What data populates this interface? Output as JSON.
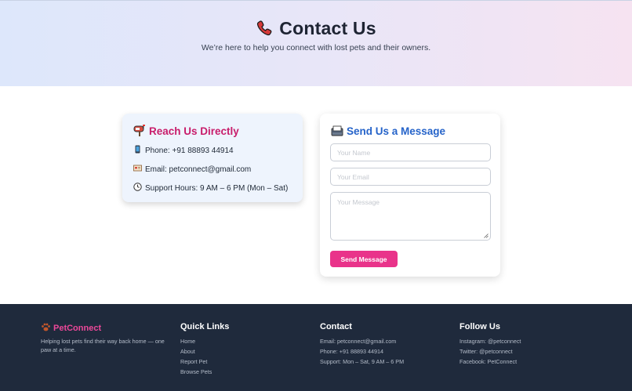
{
  "hero": {
    "title": "Contact Us",
    "subtitle": "We’re here to help you connect with lost pets and their owners.",
    "title_icon": "phone-icon"
  },
  "reach": {
    "heading": "Reach Us Directly",
    "heading_icon": "mailbox-icon",
    "phone": "Phone: +91 88893 44914",
    "email": "Email: petconnect@gmail.com",
    "hours": "Support Hours: 9 AM – 6 PM (Mon – Sat)"
  },
  "message_form": {
    "heading": "Send Us a Message",
    "heading_icon": "outbox-icon",
    "name_placeholder": "Your Name",
    "email_placeholder": "Your Email",
    "message_placeholder": "Your Message",
    "submit_label": "Send Message"
  },
  "footer": {
    "brand": "PetConnect",
    "tagline": "Helping lost pets find their way back home — one paw at a time.",
    "quick_links": {
      "heading": "Quick Links",
      "items": [
        "Home",
        "About",
        "Report Pet",
        "Browse Pets"
      ]
    },
    "contact": {
      "heading": "Contact",
      "email": "Email: petconnect@gmail.com",
      "phone": "Phone: +91 88893 44914",
      "support": "Support: Mon – Sat, 9 AM – 6 PM"
    },
    "follow": {
      "heading": "Follow Us",
      "instagram": "Instagram: @petconnect",
      "twitter": "Twitter: @petconnect",
      "facebook": "Facebook: PetConnect"
    }
  },
  "colors": {
    "accent_pink": "#e9338a",
    "heading_pink": "#c81d6b",
    "heading_blue": "#2563c9",
    "footer_bg": "#1f2a3c"
  }
}
